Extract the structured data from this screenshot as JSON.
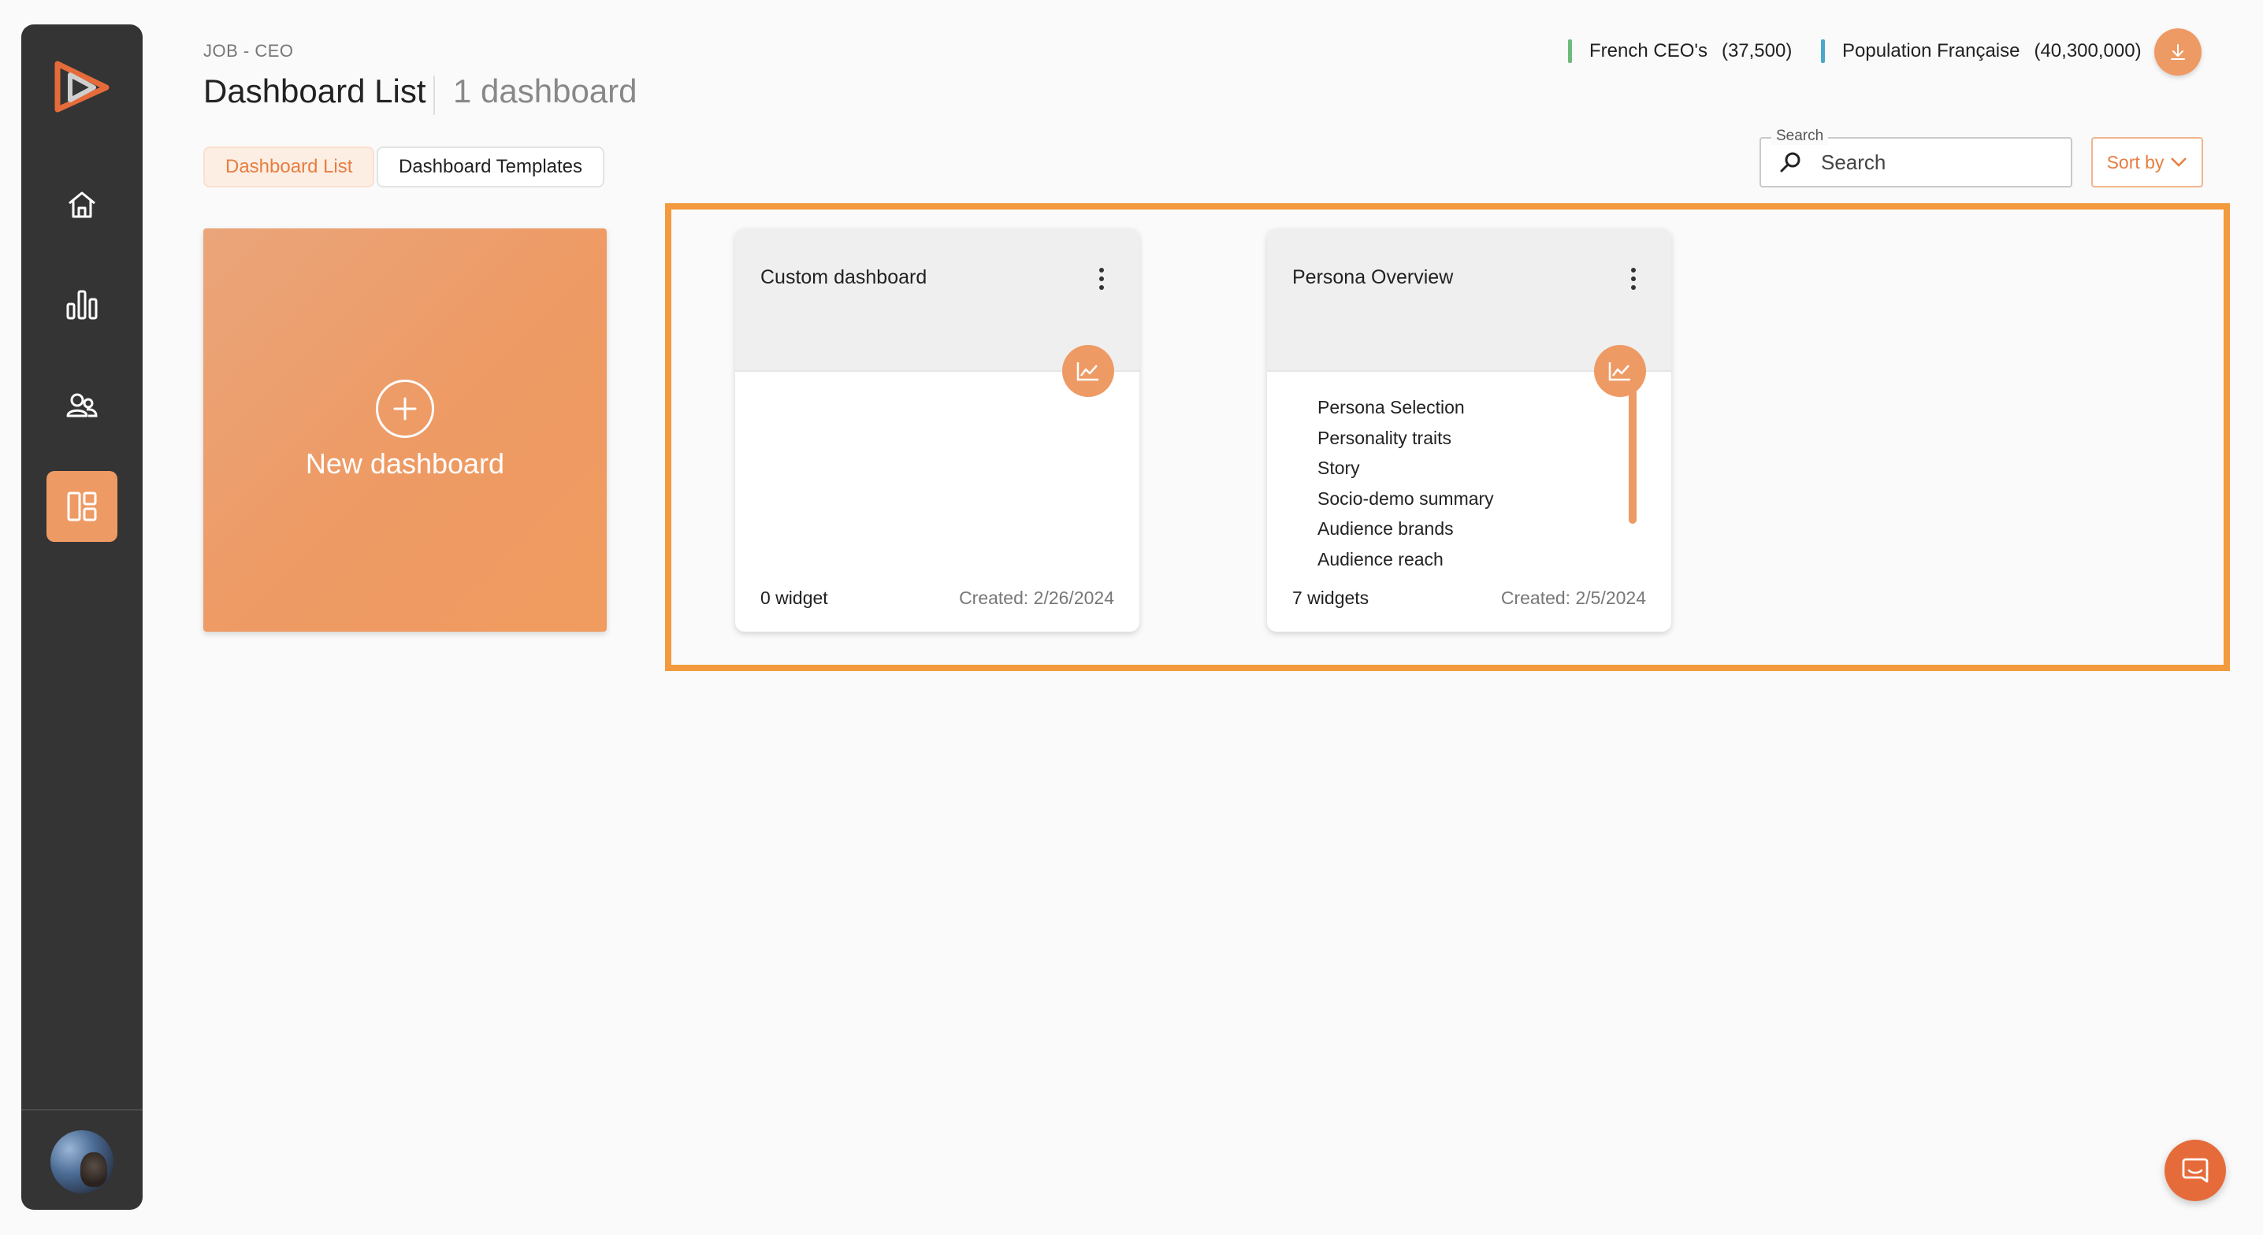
{
  "header": {
    "breadcrumb": "JOB - CEO",
    "title": "Dashboard List",
    "dashboard_count": "1 dashboard"
  },
  "tabs": [
    {
      "label": "Dashboard List",
      "active": true
    },
    {
      "label": "Dashboard Templates",
      "active": false
    }
  ],
  "legend": [
    {
      "label": "French CEO's",
      "value": "(37,500)",
      "color": "#6dbb7a"
    },
    {
      "label": "Population Française",
      "value": "(40,300,000)",
      "color": "#4aa8c9"
    }
  ],
  "search": {
    "label": "Search",
    "placeholder": "Search"
  },
  "sort": {
    "label": "Sort by"
  },
  "new_dashboard": {
    "label": "New dashboard"
  },
  "cards": [
    {
      "title": "Custom dashboard",
      "widget_count": "0 widget",
      "created": "Created: 2/26/2024",
      "widgets": []
    },
    {
      "title": "Persona Overview",
      "widget_count": "7 widgets",
      "created": "Created: 2/5/2024",
      "widgets": [
        "Persona Selection",
        "Personality traits",
        "Story",
        "Socio-demo summary",
        "Audience brands",
        "Audience reach"
      ]
    }
  ],
  "colors": {
    "accent": "#ee9a64",
    "sidebar": "#343434",
    "highlight": "#f29a3d"
  },
  "icons": {
    "nav": [
      "home-icon",
      "bar-chart-icon",
      "users-icon",
      "dashboard-icon"
    ],
    "card_badge": "line-chart-icon"
  }
}
